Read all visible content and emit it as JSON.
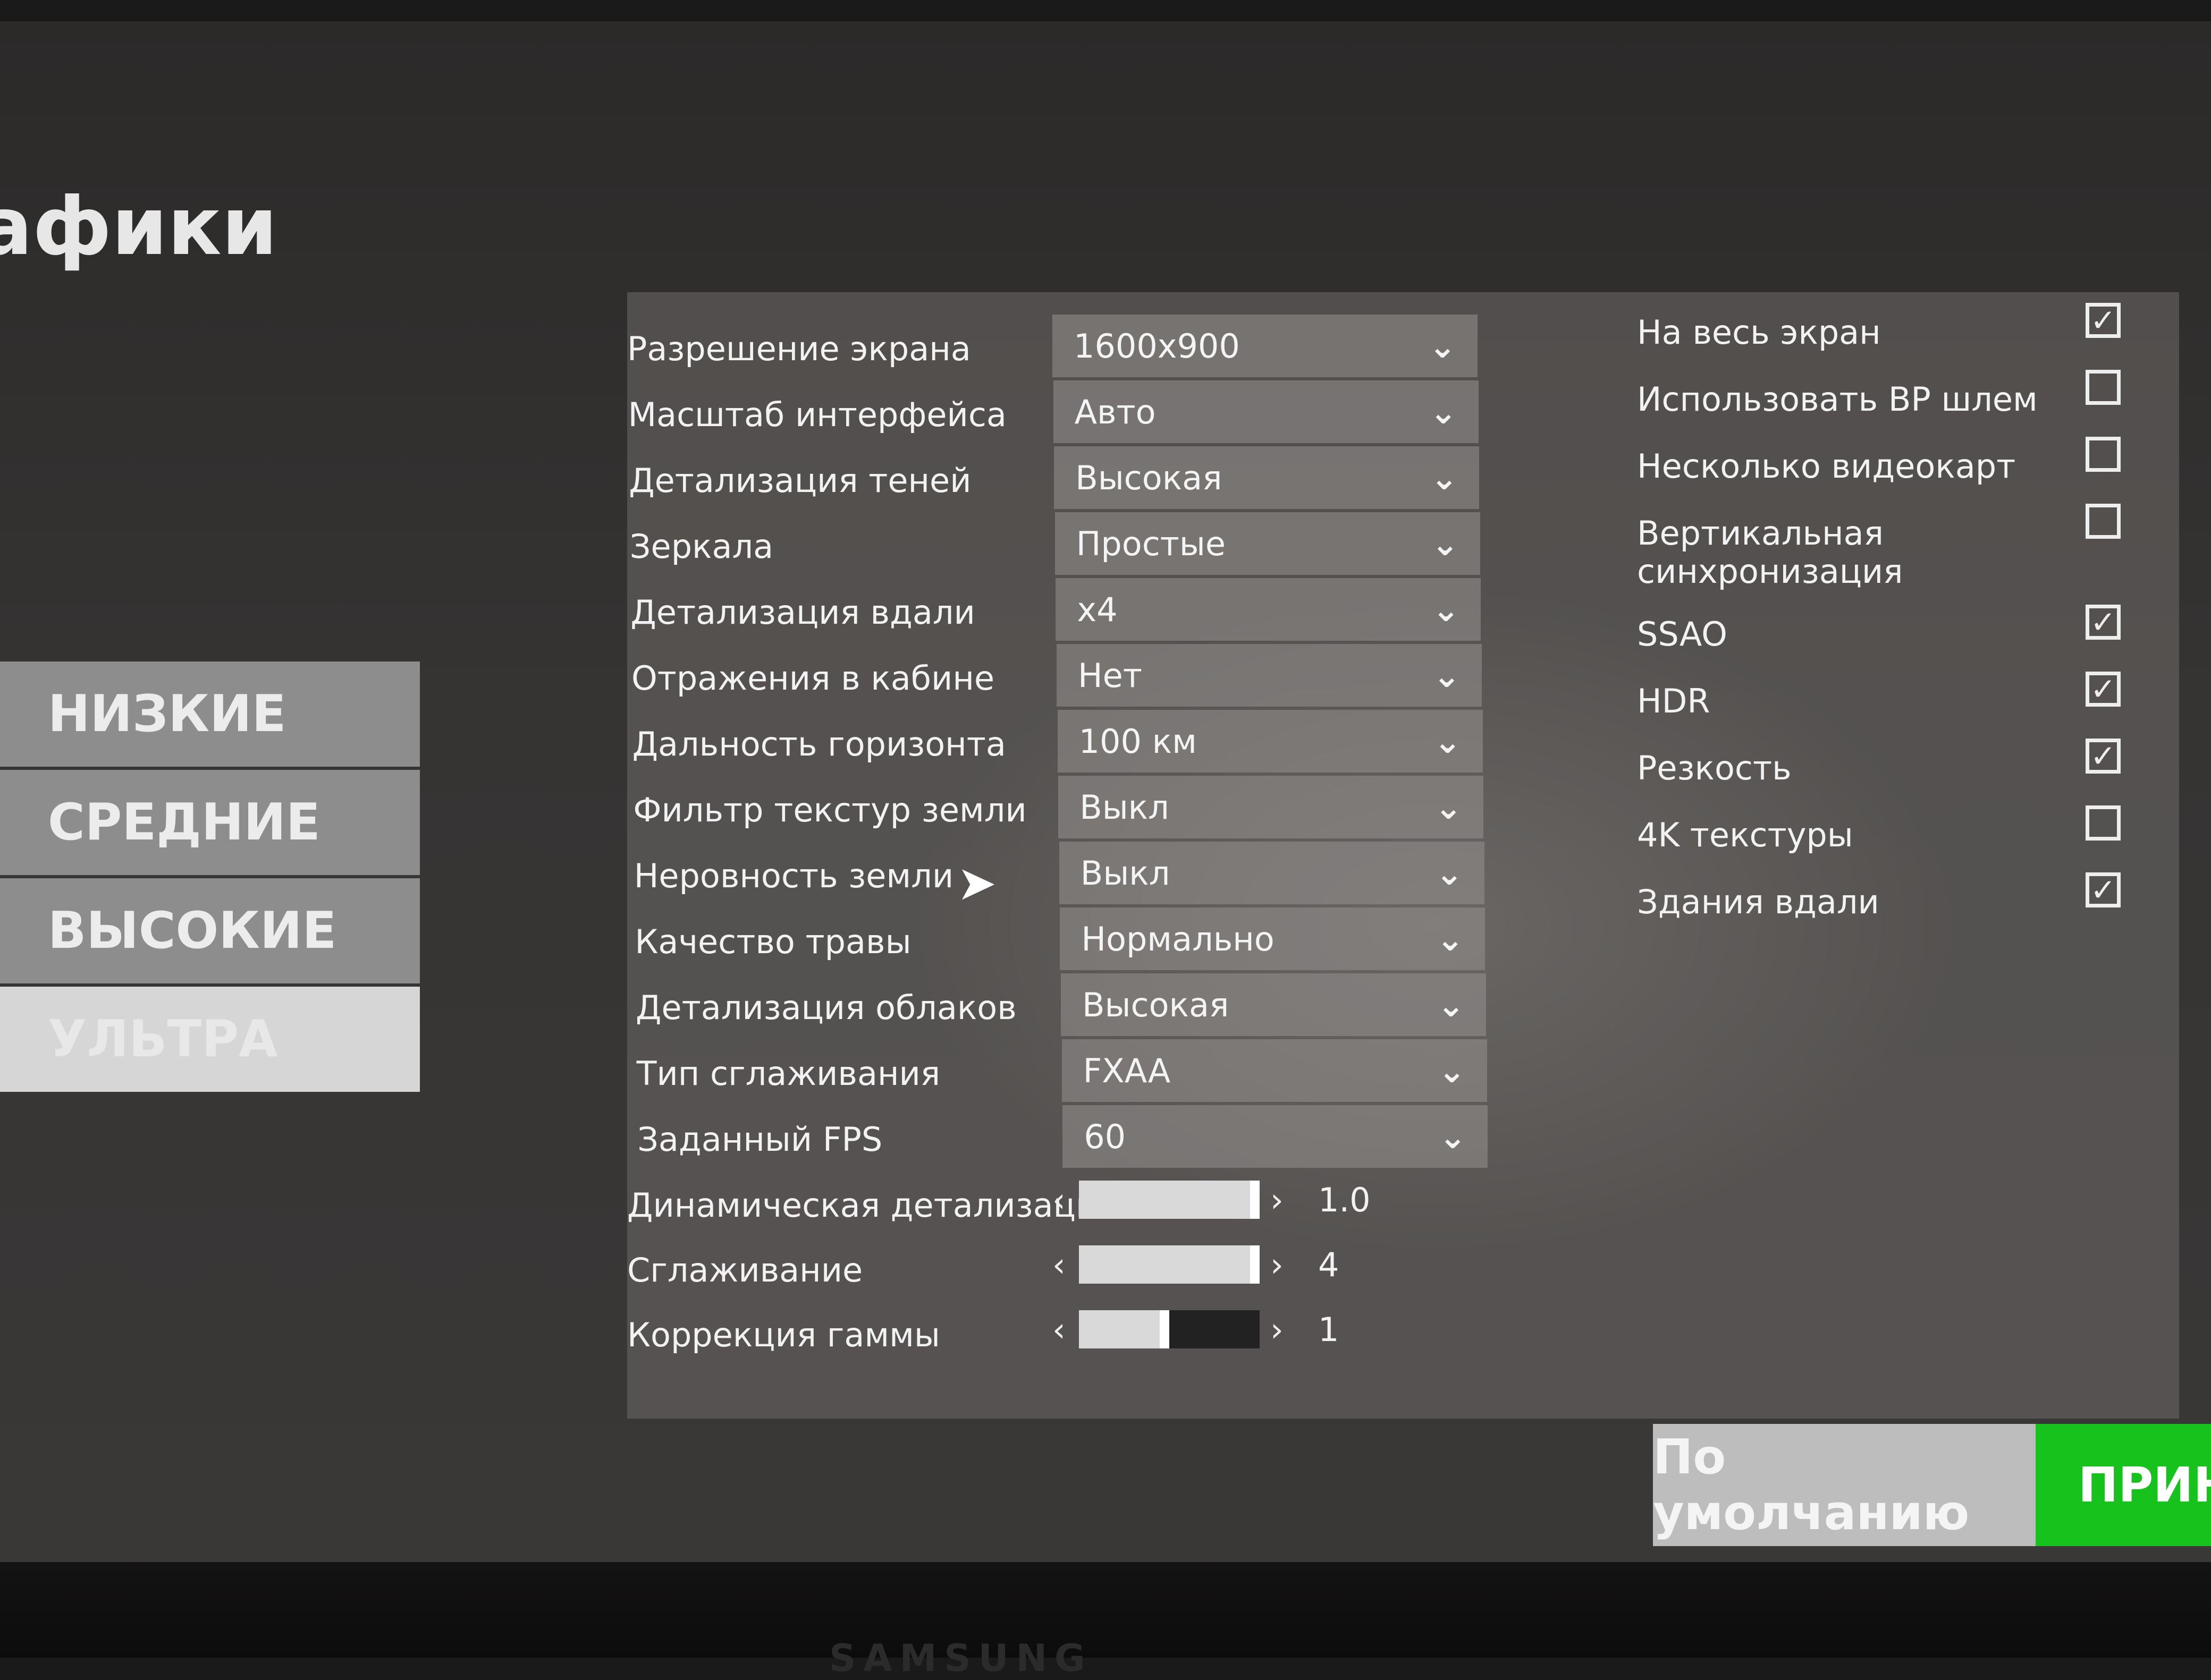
{
  "title": "афики",
  "presets": [
    "НИЗКИЕ",
    "СРЕДНИЕ",
    "ВЫСОКИЕ",
    "УЛЬТРА"
  ],
  "settings": [
    {
      "label": "Разрешение экрана",
      "value": "1600x900"
    },
    {
      "label": "Масштаб интерфейса",
      "value": "Авто"
    },
    {
      "label": "Детализация теней",
      "value": "Высокая"
    },
    {
      "label": "Зеркала",
      "value": "Простые"
    },
    {
      "label": "Детализация вдали",
      "value": "x4"
    },
    {
      "label": "Отражения в кабине",
      "value": "Нет"
    },
    {
      "label": "Дальность горизонта",
      "value": "100 км"
    },
    {
      "label": "Фильтр текстур земли",
      "value": "Выкл"
    },
    {
      "label": "Неровность земли",
      "value": "Выкл"
    },
    {
      "label": "Качество травы",
      "value": "Нормально"
    },
    {
      "label": "Детализация облаков",
      "value": "Высокая"
    },
    {
      "label": "Тип сглаживания",
      "value": "FXAA"
    },
    {
      "label": "Заданный FPS",
      "value": "60"
    }
  ],
  "sliders": [
    {
      "label": "Динамическая детализация",
      "value": "1.0",
      "fraction": 1.0
    },
    {
      "label": "Сглаживание",
      "value": "4",
      "fraction": 1.0
    },
    {
      "label": "Коррекция гаммы",
      "value": "1",
      "fraction": 0.5
    }
  ],
  "checkboxes": [
    {
      "label": "На весь экран",
      "checked": true
    },
    {
      "label": "Использовать ВР шлем",
      "checked": false
    },
    {
      "label": "Несколько видеокарт",
      "checked": false
    },
    {
      "label": "Вертикальная синхронизация",
      "checked": false
    },
    {
      "label": "SSAO",
      "checked": true
    },
    {
      "label": "HDR",
      "checked": true
    },
    {
      "label": "Резкость",
      "checked": true
    },
    {
      "label": "4K текстуры",
      "checked": false
    },
    {
      "label": "Здания вдали",
      "checked": true
    }
  ],
  "buttons": {
    "default": "По умолчанию",
    "accept": "ПРИНЯ"
  },
  "brand": "SAMSUNG"
}
